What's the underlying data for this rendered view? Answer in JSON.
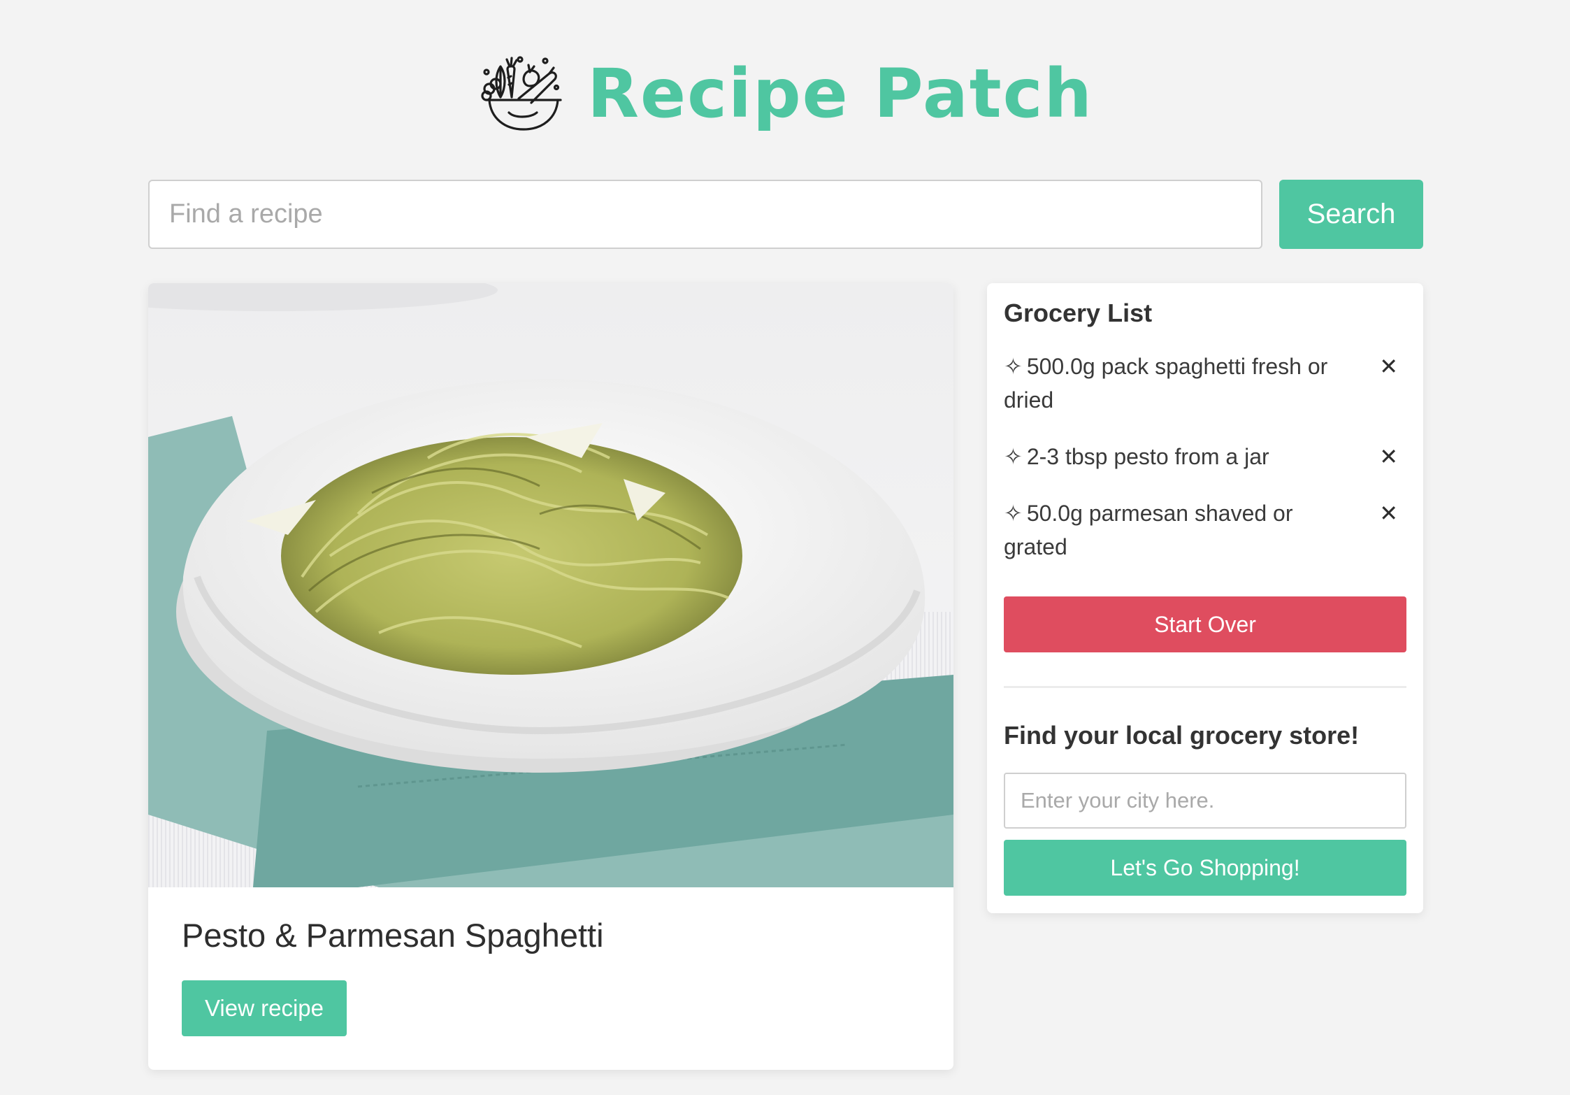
{
  "colors": {
    "brand": "#4fc6a1",
    "danger": "#df4d5f",
    "background": "#f3f3f3"
  },
  "header": {
    "brand_name": "Recipe Patch",
    "logo_icon": "salad-bowl-icon"
  },
  "search": {
    "placeholder": "Find a recipe",
    "value": "",
    "button_label": "Search"
  },
  "recipe": {
    "title": "Pesto & Parmesan Spaghetti",
    "view_label": "View recipe",
    "image_icon": "pesto-spaghetti-photo"
  },
  "grocery": {
    "title": "Grocery List",
    "bullet_glyph": "✧",
    "remove_glyph": "✕",
    "items": [
      {
        "text": "500.0g pack spaghetti fresh or dried"
      },
      {
        "text": "2-3 tbsp pesto from a jar"
      },
      {
        "text": "50.0g parmesan shaved or grated"
      }
    ],
    "start_over_label": "Start Over"
  },
  "store": {
    "title": "Find your local grocery store!",
    "placeholder": "Enter your city here.",
    "value": "",
    "button_label": "Let's Go Shopping!"
  }
}
